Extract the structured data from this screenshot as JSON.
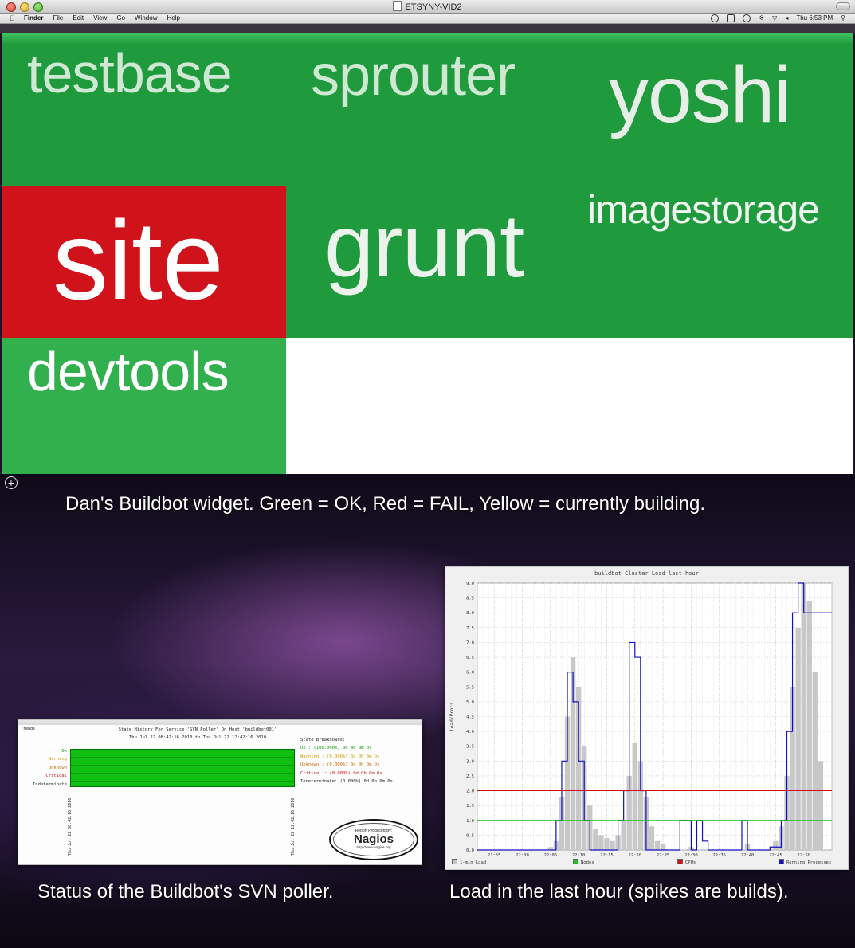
{
  "window": {
    "title": "ETSYNY-VID2",
    "menu": [
      "Finder",
      "File",
      "Edit",
      "View",
      "Go",
      "Window",
      "Help"
    ],
    "clock": "Thu 6:53 PM"
  },
  "widget": {
    "tiles": [
      {
        "name": "testbase",
        "status": "ok",
        "color": "#1f9a3c"
      },
      {
        "name": "sprouter",
        "status": "ok",
        "color": "#1f9a3c"
      },
      {
        "name": "yoshi",
        "status": "ok",
        "color": "#1f9a3c"
      },
      {
        "name": "site",
        "status": "fail",
        "color": "#d0121a"
      },
      {
        "name": "grunt",
        "status": "ok",
        "color": "#1f9a3c"
      },
      {
        "name": "imagestorage",
        "status": "ok",
        "color": "#1f9a3c"
      },
      {
        "name": "devtools",
        "status": "ok",
        "color": "#33b04e"
      }
    ]
  },
  "captions": {
    "widget": "Dan's Buildbot widget. Green = OK, Red = FAIL, Yellow = currently building.",
    "svn": "Status of the Buildbot's SVN poller.",
    "load": "Load in the last hour (spikes are builds)."
  },
  "nagios": {
    "trends": "Trends",
    "title": "State History For Service 'SVN Poller' On Host 'buildbot001'",
    "range": "Thu Jul 22 08:42:16 2010 to Thu Jul 22 12:42:16 2010",
    "states": [
      "Ok",
      "Warning",
      "Unknown",
      "Critical",
      "Indeterminate"
    ],
    "state_colors": [
      "#0a9a0a",
      "#c9a000",
      "#cc6600",
      "#d01010",
      "#222222"
    ],
    "breakdown_header": "State Breakdowns:",
    "breakdown": [
      "Ok          : (100.000%) 0d 4h 0m 0s",
      "Warning     : (0.000%) 0d 0h 0m 0s",
      "Unknown     : (0.000%) 0d 0h 0m 0s",
      "Critical    : (0.000%) 0d 0h 0m 0s",
      "Indeterminate: (0.000%) 0d 0h 0m 0s"
    ],
    "date_start": "Thu Jul 22 08:42:16 2010",
    "date_end": "Thu Jul 22 12:42:16 2010",
    "logo_small": "Report Produced By:",
    "logo_big": "Nagios",
    "logo_url": "http://www.nagios.org"
  },
  "chart_data": {
    "type": "line",
    "title": "buildbot Cluster Load last hour",
    "xlabel": "",
    "ylabel": "Load/Procs",
    "x_ticks": [
      "21:55",
      "22:00",
      "22:05",
      "22:10",
      "22:15",
      "22:20",
      "22:25",
      "22:30",
      "22:35",
      "22:40",
      "22:45",
      "22:50"
    ],
    "x_start": "21:52",
    "x_end": "22:55",
    "ylim": [
      0,
      9.0
    ],
    "y_ticks": [
      "0.0",
      "0.5",
      "1.0",
      "1.5",
      "2.0",
      "2.5",
      "3.0",
      "3.5",
      "4.0",
      "4.5",
      "5.0",
      "5.5",
      "6.0",
      "6.5",
      "7.0",
      "7.5",
      "8.0",
      "8.5",
      "9.0"
    ],
    "grid": true,
    "legend": [
      "1-min Load",
      "Nodes",
      "CPUs",
      "Running Processes"
    ],
    "legend_position": "bottom",
    "series": [
      {
        "name": "1-min Load",
        "kind": "bars",
        "color": "#c8c8c8",
        "x": [
          "22:05",
          "22:06",
          "22:07",
          "22:08",
          "22:09",
          "22:10",
          "22:11",
          "22:12",
          "22:13",
          "22:14",
          "22:15",
          "22:16",
          "22:17",
          "22:18",
          "22:19",
          "22:20",
          "22:21",
          "22:22",
          "22:23",
          "22:24",
          "22:25",
          "22:30",
          "22:40",
          "22:45",
          "22:46",
          "22:47",
          "22:48",
          "22:49",
          "22:50",
          "22:51",
          "22:52",
          "22:53"
        ],
        "values": [
          0.1,
          0.3,
          1.8,
          4.5,
          6.5,
          5.5,
          3.5,
          1.5,
          0.7,
          0.5,
          0.4,
          0.3,
          0.5,
          1.0,
          2.5,
          3.6,
          3.0,
          1.8,
          0.8,
          0.3,
          0.2,
          0.1,
          0.2,
          0.3,
          0.8,
          2.5,
          5.5,
          7.5,
          9.0,
          8.4,
          6.0,
          3.0
        ]
      },
      {
        "name": "Running Processes",
        "kind": "step",
        "color": "#1010c0",
        "x": [
          "21:52",
          "22:06",
          "22:07",
          "22:08",
          "22:09",
          "22:10",
          "22:11",
          "22:12",
          "22:17",
          "22:18",
          "22:19",
          "22:20",
          "22:21",
          "22:22",
          "22:28",
          "22:30",
          "22:31",
          "22:32",
          "22:33",
          "22:34",
          "22:35",
          "22:39",
          "22:40",
          "22:44",
          "22:46",
          "22:47",
          "22:48",
          "22:49",
          "22:50",
          "22:51",
          "22:52",
          "22:53"
        ],
        "values": [
          0,
          1,
          3.0,
          6.0,
          5.0,
          3.0,
          1.0,
          0,
          1.0,
          2.0,
          7.0,
          6.5,
          2.0,
          0,
          1.0,
          0,
          1.0,
          0.3,
          0,
          0,
          0,
          1.0,
          0,
          0.1,
          1.0,
          4.0,
          8.0,
          9.0,
          8.0,
          8.0,
          8.0,
          8.0
        ]
      },
      {
        "name": "CPUs",
        "kind": "hline",
        "color": "#d01010",
        "value": 2.0
      },
      {
        "name": "Nodes",
        "kind": "hline",
        "color": "#20c020",
        "value": 1.0
      }
    ]
  }
}
